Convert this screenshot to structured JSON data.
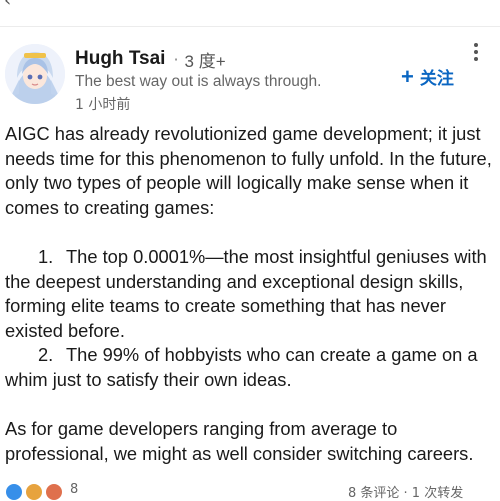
{
  "nav": {
    "back_icon": "chevron-left-icon"
  },
  "author": {
    "name": "Hugh Tsai",
    "separator": "·",
    "degree": "3 度+",
    "tagline": "The best way out is always through.",
    "time": "1 小时前"
  },
  "actions": {
    "follow_plus": "+",
    "follow_label": "关注",
    "more_icon": "more-vertical-icon"
  },
  "post": {
    "intro": "AIGC has already revolutionized game development; it just needs time for this phenomenon to fully unfold. In the future, only two types of people will logically make sense when it comes to creating games:",
    "items": [
      {
        "num": "1.",
        "text": "The top 0.0001%—the most insightful geniuses with the deepest understanding and exceptional design skills, forming elite teams to create something that has never existed before."
      },
      {
        "num": "2.",
        "text": "The 99% of hobbyists who can create a game on a whim just to satisfy their own ideas."
      }
    ],
    "outro": "As for game developers ranging from average to professional, we might as well consider switching careers."
  },
  "footer": {
    "reaction_icons": [
      "like-icon",
      "celebrate-icon",
      "love-icon"
    ],
    "reaction_colors": [
      "#378fe9",
      "#e7a33e",
      "#df704d"
    ],
    "reaction_count": "8",
    "stats": "8 条评论 · 1 次转发"
  }
}
